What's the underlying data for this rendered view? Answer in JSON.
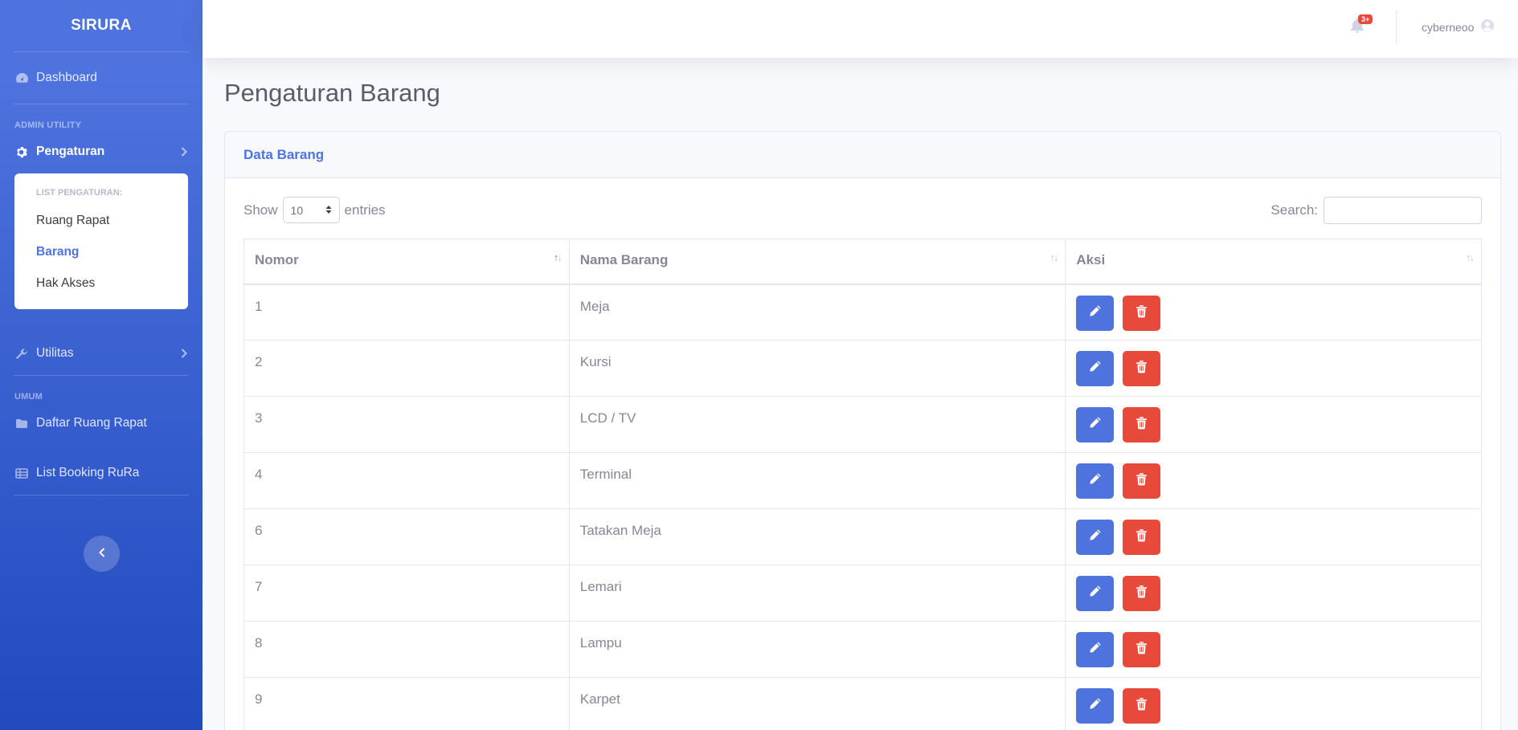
{
  "sidebar": {
    "brand": "SIRURA",
    "dashboard": "Dashboard",
    "heading_admin": "ADMIN UTILITY",
    "pengaturan": "Pengaturan",
    "submenu": {
      "heading": "LIST PENGATURAN:",
      "items": [
        "Ruang Rapat",
        "Barang",
        "Hak Akses"
      ]
    },
    "utilitas": "Utilitas",
    "heading_umum": "UMUM",
    "daftar_ruang": "Daftar Ruang Rapat",
    "list_booking": "List Booking RuRa"
  },
  "topbar": {
    "alert_count": "3+",
    "username": "cyberneoo"
  },
  "page": {
    "title": "Pengaturan Barang",
    "card_title": "Data Barang",
    "show_label": "Show",
    "entries_value": "10",
    "entries_label": "entries",
    "search_label": "Search:"
  },
  "table": {
    "headers": [
      "Nomor",
      "Nama Barang",
      "Aksi"
    ],
    "rows": [
      [
        "1",
        "Meja"
      ],
      [
        "2",
        "Kursi"
      ],
      [
        "3",
        "LCD / TV"
      ],
      [
        "4",
        "Terminal"
      ],
      [
        "6",
        "Tatakan Meja"
      ],
      [
        "7",
        "Lemari"
      ],
      [
        "8",
        "Lampu"
      ],
      [
        "9",
        "Karpet"
      ]
    ]
  },
  "colors": {
    "primary": "#4e73df",
    "danger": "#e74a3b",
    "text": "#858796"
  }
}
